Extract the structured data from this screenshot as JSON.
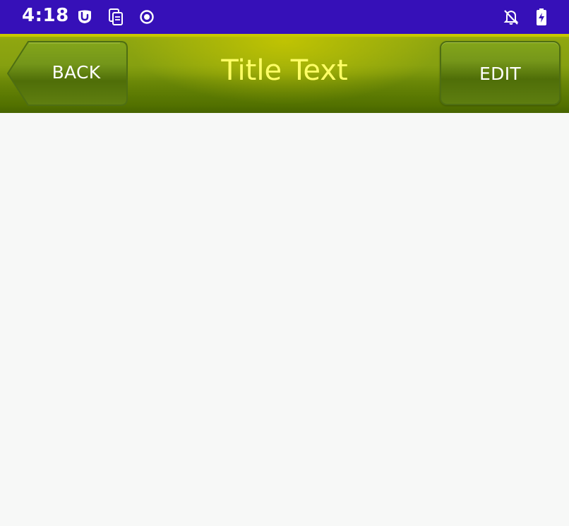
{
  "status_bar": {
    "time": "4:18",
    "icons": [
      "app-notification-icon",
      "document-icon",
      "record-icon",
      "notifications-off-icon",
      "battery-charging-icon"
    ],
    "background_color": "#3610b8"
  },
  "action_bar": {
    "title": "Title Text",
    "back_label": "BACK",
    "edit_label": "EDIT",
    "title_color": "#ffff66",
    "background_color": "#86a010"
  },
  "content": {
    "background_color": "#f7f8f7"
  }
}
